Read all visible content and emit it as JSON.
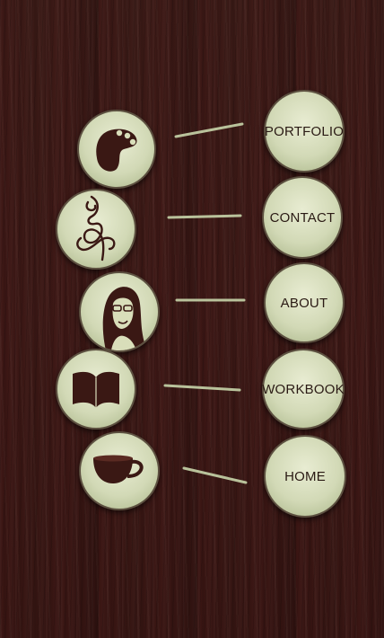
{
  "nav": {
    "portfolio": "PORTFOLIO",
    "contact": "CONTACT",
    "about": "ABOUT",
    "workbook": "WORKBOOK",
    "home": "HOME"
  },
  "icons": [
    "palette-icon",
    "calligraphy-monogram-icon",
    "avatar-portrait-icon",
    "open-book-icon",
    "teacup-icon"
  ],
  "colors": {
    "circle_fill": "#d2d9b6",
    "icon_dark": "#3a1814",
    "line": "#b9c29b"
  }
}
